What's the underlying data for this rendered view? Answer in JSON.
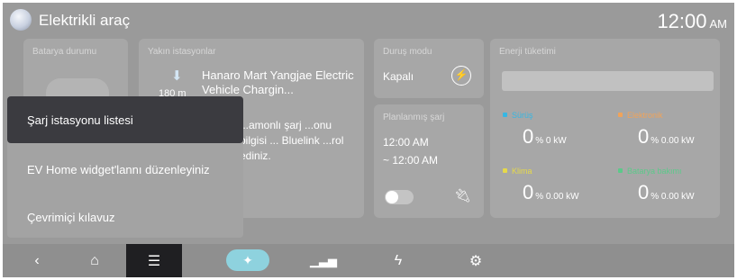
{
  "header": {
    "title": "Elektrikli araç",
    "time": "12:00",
    "ampm": "AM"
  },
  "cards": {
    "battery": {
      "title": "Batarya durumu"
    },
    "nearby": {
      "title": "Yakın istasyonlar",
      "distance": "180 m",
      "station_name": "Hanaro Mart Yangjae Electric Vehicle Chargin...",
      "info_text": "...amonlı şarj ...onu bilgisi ... Bluelink ...rol ediniz."
    },
    "drive_mode": {
      "title": "Duruş modu",
      "value": "Kapalı"
    },
    "scheduled": {
      "title": "Planlanmış şarj",
      "time_start": "12:00 AM",
      "time_end": "~ 12:00 AM"
    },
    "energy": {
      "title": "Enerji tüketimi",
      "metrics": [
        {
          "label": "Sürüş",
          "value": "0",
          "unit": "% 0 kW",
          "color": "#37b7e3"
        },
        {
          "label": "Elektronik",
          "value": "0",
          "unit": "% 0.00 kW",
          "color": "#f0a35a"
        },
        {
          "label": "Klima",
          "value": "0",
          "unit": "% 0.00 kW",
          "color": "#e6d94a"
        },
        {
          "label": "Batarya bakımı",
          "value": "0",
          "unit": "% 0.00 kW",
          "color": "#5cc98a"
        }
      ]
    }
  },
  "menu": {
    "items": [
      {
        "label": "Şarj istasyonu listesi"
      },
      {
        "label": "EV Home widget'lannı düzenleyiniz"
      },
      {
        "label": "Çevrimiçi kılavuz"
      }
    ]
  },
  "navbar": {
    "icons": [
      "back-icon",
      "home-icon",
      "menu-icon",
      "ev-leaf-icon",
      "energy-chart-icon",
      "charger-icon",
      "settings-icon"
    ]
  },
  "colors": {
    "ev_accent": "#8ed2de",
    "menu_active": "#3b3b40",
    "navbar_active": "#1f1f22"
  }
}
